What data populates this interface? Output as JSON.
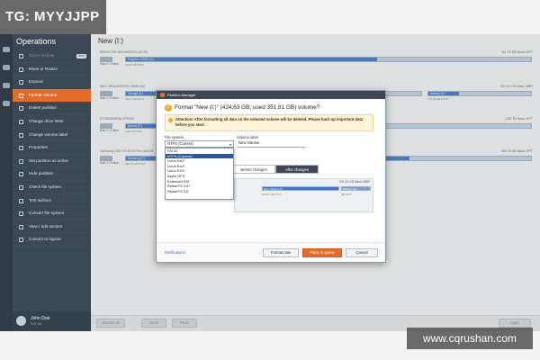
{
  "watermarks": {
    "top_left": "TG: MYYJJPP",
    "bottom_right": "www.cqrushan.com"
  },
  "sidebar": {
    "title": "Operations",
    "items": [
      {
        "label": "Clone Volume",
        "badge": "Beta",
        "state": "dim"
      },
      {
        "label": "Move or Resize"
      },
      {
        "label": "Expand"
      },
      {
        "label": "Format Volume",
        "state": "active"
      },
      {
        "label": "Delete partition"
      },
      {
        "label": "Change drive letter"
      },
      {
        "label": "Change volume label"
      },
      {
        "label": "Properties"
      },
      {
        "label": "Set partition as active"
      },
      {
        "label": "Hide partition"
      },
      {
        "label": "Check file system"
      },
      {
        "label": "Test surface"
      },
      {
        "label": "Convert file system"
      },
      {
        "label": "View / edit sectors"
      },
      {
        "label": "Convert to logical"
      }
    ],
    "user": {
      "name": "John Doe",
      "status": "Full ver."
    }
  },
  "main": {
    "title": "New (I:)",
    "disks": [
      {
        "header": "KINGSTON SUV400S37A (SCSI)",
        "size": "111,79 GB Basic GPT",
        "caption": "Disk 0 / Online",
        "bar_label": "Kingston 120Gb (C:)",
        "sub": "119,8 GB NTFS",
        "fill": 0.62
      },
      {
        "header": "WDC WD1003FZEX-00MK2A0",
        "size": "931,51 GB Basic MBR",
        "caption": "Disk 1 / Online",
        "bar_label": "Storage (D:)",
        "sub": "349,5 GB NTFS",
        "extra_label": "Backup (G:)",
        "extra_sub": "170,18 GB NTFS",
        "fill": 0.42
      },
      {
        "header": "ST2000DM008-2FR102",
        "size": "1,82 TB Basic GPT",
        "caption": "Disk 2 / Online",
        "bar_label": "Movies (F:)",
        "sub": "1,82 TB NTFS",
        "fill": 0.55
      },
      {
        "header": "Samsung SSD 970 EVO Plus 500GB",
        "size": "465,76 GB Basic GPT",
        "caption": "Disk 3 / Online",
        "bar_label": "Samsung (E:)",
        "sub": "465,76 GB NTFS",
        "fill": 0.7
      }
    ]
  },
  "bottom": {
    "discard": "Discard all",
    "undo": "Undo",
    "redo": "Redo",
    "apply": "Apply"
  },
  "dialog": {
    "window_title": "Partition Manager",
    "heading": "Format \"New (I:)\" (424,63 GB, used 351,81 GB) volume?",
    "warning": "Attention! After formatting all data on the selected volume will be deleted. Please back up important data before you start.",
    "file_system_label": "File system",
    "file_system_value": "NTFS (Current)",
    "volume_label_label": "Volume label",
    "volume_label_value": "New Volume",
    "options": [
      "FAT32",
      "NTFS (Current)",
      "Linux Ext2",
      "Linux Ext3",
      "Linux Ext4",
      "Apple HFS",
      "Extended FAT",
      "ReiserFS 3.6+",
      "ReiserFS 3.6"
    ],
    "selected_option": "NTFS (Current)",
    "tab_before": "Before changes",
    "tab_after": "After changes",
    "preview": {
      "size": "931,51 GB Basic MBR",
      "disk_caption": "Disk 1 / Online",
      "bar1_label": "New Volume (I:)",
      "bar1_sub": "424,63 GB NTFS",
      "bar2_label": "Backup (G:)",
      "bar2_sub": "GB NTFS"
    },
    "link": "Notifications",
    "btn_format": "Format now",
    "btn_queue": "Place in queue",
    "btn_cancel": "Cancel"
  }
}
